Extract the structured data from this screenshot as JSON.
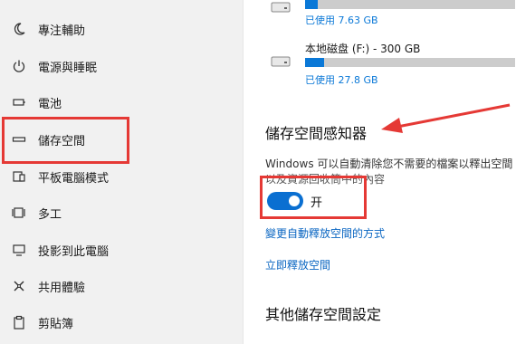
{
  "sidebar": {
    "items": [
      {
        "label": "專注輔助",
        "icon": "moon-icon"
      },
      {
        "label": "電源與睡眠",
        "icon": "power-icon"
      },
      {
        "label": "電池",
        "icon": "battery-icon"
      },
      {
        "label": "儲存空間",
        "icon": "storage-icon",
        "highlighted": true
      },
      {
        "label": "平板電腦模式",
        "icon": "tablet-mode-icon"
      },
      {
        "label": "多工",
        "icon": "multitasking-icon"
      },
      {
        "label": "投影到此電腦",
        "icon": "project-icon"
      },
      {
        "label": "共用體驗",
        "icon": "shared-experiences-icon"
      },
      {
        "label": "剪貼簿",
        "icon": "clipboard-icon"
      }
    ]
  },
  "drives": [
    {
      "title": "",
      "used_text": "已使用 7.63 GB",
      "used_fraction": 0.06
    },
    {
      "title": "本地磁盘 (F:) - 300 GB",
      "used_text": "已使用 27.8 GB",
      "used_fraction": 0.09
    }
  ],
  "storage_sense": {
    "title": "儲存空間感知器",
    "description_line1": "Windows 可以自動清除您不需要的檔案以釋出空間",
    "description_line2": "以及資源回收筒中的內容",
    "toggle_state_label": "开",
    "toggle_on": true,
    "link_change": "變更自動釋放空間的方式",
    "link_free_now": "立即釋放空間"
  },
  "other_settings": {
    "title": "其他儲存空間設定"
  },
  "colors": {
    "accent": "#0a78d7",
    "highlight_red": "#e53935"
  }
}
